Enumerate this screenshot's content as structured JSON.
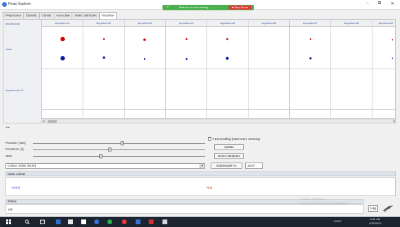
{
  "window": {
    "title": "Pirate Explorer",
    "minimize": "–",
    "maximize": "⧉",
    "close": "✕"
  },
  "share_bar": {
    "message": "Rita.com is now sharing",
    "stop_label": "■ Stop Share"
  },
  "tabs": [
    {
      "label": "Preprocess",
      "active": false
    },
    {
      "label": "Classify",
      "active": false
    },
    {
      "label": "Cluster",
      "active": false
    },
    {
      "label": "Associate",
      "active": false
    },
    {
      "label": "Select attributes",
      "active": false
    },
    {
      "label": "Visualize",
      "active": true
    }
  ],
  "grid": {
    "columns": [
      "departsont1",
      "departsont2",
      "departsont3",
      "departsont4",
      "departsont5",
      "departsont6",
      "departsont7",
      "departsont8",
      "departsont9"
    ],
    "rows": [
      {
        "label": "class"
      },
      {
        "label": "departsont1 M"
      }
    ],
    "colors": {
      "class_a": "#d00000",
      "class_b": "#0a1aa0",
      "header_text": "#4a5a9a"
    }
  },
  "controls": {
    "resize_dots": "◂ ▸",
    "plot_size_label": "PlotSize: [100]",
    "point_size_label": "PointSize: [1]",
    "jitter_label": "Jitter",
    "color_dropdown": "Colour: Iclass (Nom)",
    "fast_scrolling_label": "Fast scrolling (uses more memory)",
    "update_button": "Update",
    "select_attributes_button": "Select Attributes",
    "subsample_button": "SubSample %:",
    "subsample_value": "15.67"
  },
  "class_colour": {
    "header": "Class Colour",
    "labels": [
      {
        "text": "tested",
        "color": "#4a5ad8"
      },
      {
        "text": "Reg",
        "color": "#d04020"
      }
    ]
  },
  "status": {
    "header": "Status",
    "text": "OK",
    "log_button": "Log",
    "watermark_line1": "Activate Windows",
    "watermark_line2": "Go to Settings to activate Windows."
  },
  "taskbar": {
    "tray_text": "^ ENG",
    "clock_time": "8:45 AM",
    "clock_date": "4/25/2022"
  }
}
